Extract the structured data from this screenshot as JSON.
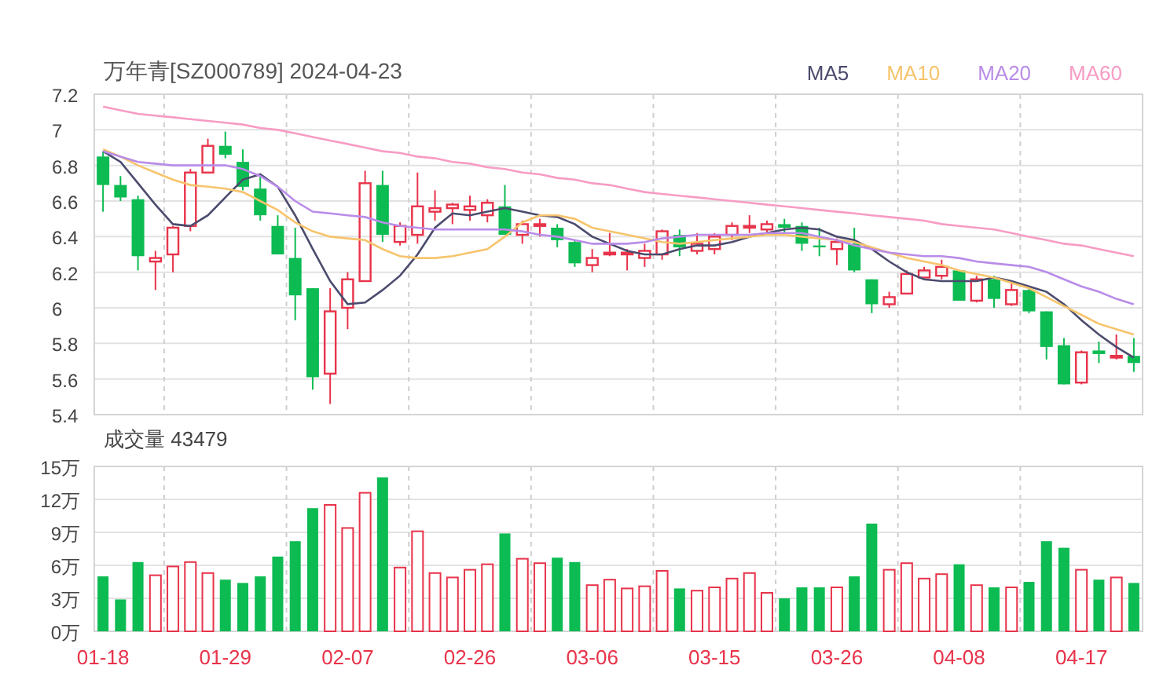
{
  "header": {
    "title": "万年青[SZ000789] 2024-04-23"
  },
  "price_chart": {
    "chart_data": {
      "type": "candlestick",
      "grid": true,
      "ylim": [
        5.4,
        7.2
      ],
      "categories": [
        null,
        null,
        null,
        null,
        null,
        null,
        null,
        null,
        null,
        null,
        null,
        null,
        null,
        null,
        null,
        null,
        null,
        null,
        null,
        null,
        null,
        null,
        null,
        null,
        null,
        null,
        null,
        null,
        null,
        null,
        null,
        null,
        null,
        null,
        null,
        null,
        null,
        null,
        null,
        null,
        null,
        null,
        null,
        null,
        null,
        null,
        null,
        null,
        null,
        null,
        null,
        null,
        null,
        null,
        null,
        null,
        null,
        null,
        null,
        null
      ],
      "yticks": [
        {
          "value": 7.2,
          "label": "7.2"
        },
        {
          "value": 7,
          "label": "7"
        },
        {
          "value": 6.8,
          "label": "6.8"
        },
        {
          "value": 6.6,
          "label": "6.6"
        },
        {
          "value": 6.4,
          "label": "6.4"
        },
        {
          "value": 6.2,
          "label": "6.2"
        },
        {
          "value": 6,
          "label": "6"
        },
        {
          "value": 5.8,
          "label": "5.8"
        },
        {
          "value": 5.6,
          "label": "5.6"
        },
        {
          "value": 5.4,
          "label": "5.4"
        }
      ],
      "series": [
        {
          "name": "MA5",
          "type": "line",
          "color": "#4b4b6e",
          "values": [
            6.88,
            6.82,
            6.7,
            6.58,
            6.47,
            6.46,
            6.52,
            6.62,
            6.72,
            6.75,
            6.68,
            6.52,
            6.33,
            6.15,
            6.02,
            6.03,
            6.1,
            6.18,
            6.3,
            6.45,
            6.53,
            6.52,
            6.54,
            6.56,
            6.54,
            6.52,
            6.51,
            6.47,
            6.4,
            6.36,
            6.32,
            6.3,
            6.3,
            6.33,
            6.35,
            6.35,
            6.37,
            6.4,
            6.42,
            6.44,
            6.45,
            6.44,
            6.4,
            6.38,
            6.33,
            6.26,
            6.2,
            6.16,
            6.15,
            6.15,
            6.15,
            6.17,
            6.15,
            6.12,
            6.09,
            6.02,
            5.93,
            5.85,
            5.78,
            5.72
          ]
        },
        {
          "name": "MA10",
          "type": "line",
          "color": "#f7c46c",
          "values": [
            6.89,
            6.85,
            6.8,
            6.76,
            6.72,
            6.69,
            6.68,
            6.67,
            6.65,
            6.6,
            6.55,
            6.48,
            6.43,
            6.4,
            6.39,
            6.38,
            6.33,
            6.29,
            6.28,
            6.28,
            6.29,
            6.31,
            6.33,
            6.4,
            6.48,
            6.52,
            6.52,
            6.5,
            6.45,
            6.43,
            6.41,
            6.39,
            6.37,
            6.36,
            6.37,
            6.38,
            6.39,
            6.4,
            6.41,
            6.41,
            6.4,
            6.39,
            6.38,
            6.37,
            6.34,
            6.31,
            6.28,
            6.26,
            6.24,
            6.21,
            6.19,
            6.17,
            6.14,
            6.11,
            6.06,
            6.01,
            5.96,
            5.91,
            5.88,
            5.85
          ]
        },
        {
          "name": "MA20",
          "type": "line",
          "color": "#b98ce8",
          "values": [
            6.88,
            6.85,
            6.82,
            6.81,
            6.8,
            6.8,
            6.8,
            6.8,
            6.78,
            6.74,
            6.68,
            6.6,
            6.54,
            6.53,
            6.52,
            6.51,
            6.48,
            6.46,
            6.45,
            6.44,
            6.44,
            6.44,
            6.44,
            6.44,
            6.43,
            6.41,
            6.4,
            6.38,
            6.36,
            6.36,
            6.36,
            6.37,
            6.39,
            6.4,
            6.41,
            6.41,
            6.41,
            6.41,
            6.42,
            6.42,
            6.42,
            6.4,
            6.38,
            6.35,
            6.33,
            6.31,
            6.3,
            6.29,
            6.29,
            6.28,
            6.26,
            6.25,
            6.24,
            6.23,
            6.2,
            6.16,
            6.12,
            6.09,
            6.05,
            6.02
          ]
        },
        {
          "name": "MA60",
          "type": "line",
          "color": "#f79cc4",
          "values": [
            7.13,
            7.11,
            7.09,
            7.08,
            7.07,
            7.06,
            7.05,
            7.04,
            7.03,
            7.01,
            7.0,
            6.98,
            6.96,
            6.94,
            6.92,
            6.9,
            6.88,
            6.87,
            6.85,
            6.84,
            6.82,
            6.81,
            6.79,
            6.78,
            6.76,
            6.75,
            6.73,
            6.72,
            6.7,
            6.69,
            6.67,
            6.65,
            6.64,
            6.63,
            6.62,
            6.61,
            6.6,
            6.59,
            6.58,
            6.57,
            6.56,
            6.55,
            6.54,
            6.53,
            6.52,
            6.51,
            6.5,
            6.49,
            6.47,
            6.46,
            6.45,
            6.44,
            6.42,
            6.4,
            6.38,
            6.36,
            6.35,
            6.33,
            6.31,
            6.29
          ]
        }
      ],
      "ohlc": [
        [
          6.85,
          6.88,
          6.54,
          6.69
        ],
        [
          6.69,
          6.74,
          6.6,
          6.62
        ],
        [
          6.61,
          6.63,
          6.21,
          6.29
        ],
        [
          6.26,
          6.32,
          6.1,
          6.28
        ],
        [
          6.3,
          6.46,
          6.2,
          6.45
        ],
        [
          6.46,
          6.78,
          6.43,
          6.76
        ],
        [
          6.76,
          6.95,
          6.76,
          6.91
        ],
        [
          6.91,
          6.99,
          6.84,
          6.86
        ],
        [
          6.82,
          6.89,
          6.66,
          6.68
        ],
        [
          6.67,
          6.74,
          6.49,
          6.52
        ],
        [
          6.46,
          6.52,
          6.3,
          6.3
        ],
        [
          6.28,
          6.45,
          5.93,
          6.07
        ],
        [
          6.11,
          6.11,
          5.54,
          5.61
        ],
        [
          5.63,
          6.11,
          5.46,
          5.98
        ],
        [
          6.0,
          6.2,
          5.88,
          6.16
        ],
        [
          6.15,
          6.77,
          6.15,
          6.7
        ],
        [
          6.69,
          6.77,
          6.37,
          6.41
        ],
        [
          6.37,
          6.48,
          6.35,
          6.46
        ],
        [
          6.41,
          6.76,
          6.36,
          6.57
        ],
        [
          6.54,
          6.66,
          6.49,
          6.56
        ],
        [
          6.56,
          6.59,
          6.47,
          6.58
        ],
        [
          6.55,
          6.63,
          6.49,
          6.57
        ],
        [
          6.52,
          6.61,
          6.48,
          6.59
        ],
        [
          6.57,
          6.69,
          6.41,
          6.41
        ],
        [
          6.41,
          6.49,
          6.36,
          6.47
        ],
        [
          6.46,
          6.5,
          6.4,
          6.47
        ],
        [
          6.45,
          6.47,
          6.34,
          6.38
        ],
        [
          6.37,
          6.38,
          6.23,
          6.25
        ],
        [
          6.24,
          6.33,
          6.2,
          6.28
        ],
        [
          6.3,
          6.42,
          6.29,
          6.31
        ],
        [
          6.3,
          6.33,
          6.21,
          6.31
        ],
        [
          6.28,
          6.36,
          6.23,
          6.32
        ],
        [
          6.3,
          6.44,
          6.27,
          6.43
        ],
        [
          6.41,
          6.44,
          6.29,
          6.34
        ],
        [
          6.32,
          6.42,
          6.3,
          6.36
        ],
        [
          6.33,
          6.42,
          6.3,
          6.4
        ],
        [
          6.41,
          6.48,
          6.38,
          6.46
        ],
        [
          6.45,
          6.52,
          6.42,
          6.46
        ],
        [
          6.44,
          6.49,
          6.42,
          6.47
        ],
        [
          6.47,
          6.5,
          6.42,
          6.45
        ],
        [
          6.46,
          6.48,
          6.32,
          6.36
        ],
        [
          6.35,
          6.45,
          6.29,
          6.34
        ],
        [
          6.33,
          6.39,
          6.24,
          6.37
        ],
        [
          6.36,
          6.45,
          6.2,
          6.21
        ],
        [
          6.16,
          6.16,
          5.97,
          6.02
        ],
        [
          6.02,
          6.09,
          6.0,
          6.06
        ],
        [
          6.08,
          6.21,
          6.08,
          6.19
        ],
        [
          6.17,
          6.23,
          6.17,
          6.21
        ],
        [
          6.18,
          6.27,
          6.16,
          6.23
        ],
        [
          6.21,
          6.21,
          6.04,
          6.04
        ],
        [
          6.04,
          6.18,
          6.03,
          6.16
        ],
        [
          6.16,
          6.18,
          6.0,
          6.05
        ],
        [
          6.02,
          6.14,
          6.01,
          6.1
        ],
        [
          6.1,
          6.12,
          5.97,
          5.98
        ],
        [
          5.98,
          5.98,
          5.71,
          5.78
        ],
        [
          5.79,
          5.83,
          5.57,
          5.57
        ],
        [
          5.58,
          5.76,
          5.57,
          5.75
        ],
        [
          5.76,
          5.81,
          5.69,
          5.74
        ],
        [
          5.72,
          5.85,
          5.71,
          5.73
        ],
        [
          5.73,
          5.83,
          5.64,
          5.69
        ]
      ]
    }
  },
  "volume_chart": {
    "title": "成交量 43479",
    "chart_data": {
      "type": "bar",
      "grid": true,
      "ylim": [
        0,
        15
      ],
      "categories": [
        "01-18",
        null,
        null,
        null,
        null,
        null,
        null,
        "01-29",
        null,
        null,
        null,
        null,
        null,
        null,
        "02-07",
        null,
        null,
        null,
        null,
        null,
        null,
        "02-26",
        null,
        null,
        null,
        null,
        null,
        null,
        "03-06",
        null,
        null,
        null,
        null,
        null,
        null,
        "03-15",
        null,
        null,
        null,
        null,
        null,
        null,
        "03-26",
        null,
        null,
        null,
        null,
        null,
        null,
        "04-08",
        null,
        null,
        null,
        null,
        null,
        null,
        "04-17",
        null,
        null,
        null
      ],
      "yticks": [
        {
          "value": 15,
          "label": "15万"
        },
        {
          "value": 12,
          "label": "12万"
        },
        {
          "value": 9,
          "label": "9万"
        },
        {
          "value": 6,
          "label": "6万"
        },
        {
          "value": 3,
          "label": "3万"
        },
        {
          "value": 0,
          "label": "0万"
        }
      ],
      "values": [
        5.0,
        2.9,
        6.3,
        5.1,
        5.9,
        6.3,
        5.3,
        4.7,
        4.4,
        5.0,
        6.8,
        8.2,
        11.2,
        11.5,
        9.4,
        12.6,
        14.0,
        5.8,
        9.1,
        5.3,
        4.9,
        5.6,
        6.1,
        8.9,
        6.6,
        6.2,
        6.7,
        6.3,
        4.2,
        4.7,
        3.9,
        4.1,
        5.5,
        3.9,
        3.7,
        4.0,
        4.8,
        5.3,
        3.5,
        3.0,
        4.0,
        4.0,
        4.0,
        5.0,
        9.8,
        5.6,
        6.2,
        4.8,
        5.2,
        6.1,
        4.2,
        4.0,
        4.0,
        4.5,
        8.2,
        7.6,
        5.6,
        4.7,
        4.9,
        4.4
      ]
    }
  }
}
